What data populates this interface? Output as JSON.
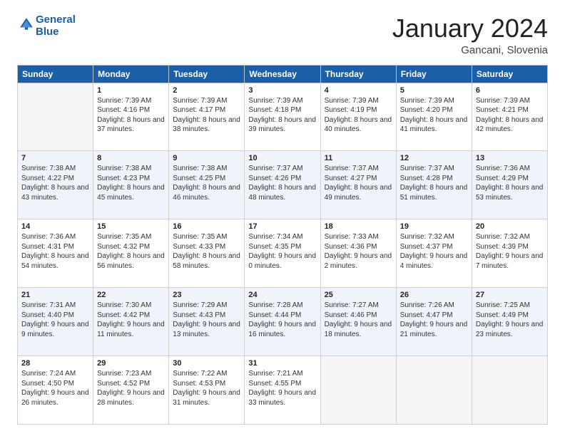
{
  "header": {
    "logo_line1": "General",
    "logo_line2": "Blue",
    "month": "January 2024",
    "location": "Gancani, Slovenia"
  },
  "days_of_week": [
    "Sunday",
    "Monday",
    "Tuesday",
    "Wednesday",
    "Thursday",
    "Friday",
    "Saturday"
  ],
  "weeks": [
    [
      {
        "day": "",
        "sunrise": "",
        "sunset": "",
        "daylight": ""
      },
      {
        "day": "1",
        "sunrise": "Sunrise: 7:39 AM",
        "sunset": "Sunset: 4:16 PM",
        "daylight": "Daylight: 8 hours and 37 minutes."
      },
      {
        "day": "2",
        "sunrise": "Sunrise: 7:39 AM",
        "sunset": "Sunset: 4:17 PM",
        "daylight": "Daylight: 8 hours and 38 minutes."
      },
      {
        "day": "3",
        "sunrise": "Sunrise: 7:39 AM",
        "sunset": "Sunset: 4:18 PM",
        "daylight": "Daylight: 8 hours and 39 minutes."
      },
      {
        "day": "4",
        "sunrise": "Sunrise: 7:39 AM",
        "sunset": "Sunset: 4:19 PM",
        "daylight": "Daylight: 8 hours and 40 minutes."
      },
      {
        "day": "5",
        "sunrise": "Sunrise: 7:39 AM",
        "sunset": "Sunset: 4:20 PM",
        "daylight": "Daylight: 8 hours and 41 minutes."
      },
      {
        "day": "6",
        "sunrise": "Sunrise: 7:39 AM",
        "sunset": "Sunset: 4:21 PM",
        "daylight": "Daylight: 8 hours and 42 minutes."
      }
    ],
    [
      {
        "day": "7",
        "sunrise": "Sunrise: 7:38 AM",
        "sunset": "Sunset: 4:22 PM",
        "daylight": "Daylight: 8 hours and 43 minutes."
      },
      {
        "day": "8",
        "sunrise": "Sunrise: 7:38 AM",
        "sunset": "Sunset: 4:23 PM",
        "daylight": "Daylight: 8 hours and 45 minutes."
      },
      {
        "day": "9",
        "sunrise": "Sunrise: 7:38 AM",
        "sunset": "Sunset: 4:25 PM",
        "daylight": "Daylight: 8 hours and 46 minutes."
      },
      {
        "day": "10",
        "sunrise": "Sunrise: 7:37 AM",
        "sunset": "Sunset: 4:26 PM",
        "daylight": "Daylight: 8 hours and 48 minutes."
      },
      {
        "day": "11",
        "sunrise": "Sunrise: 7:37 AM",
        "sunset": "Sunset: 4:27 PM",
        "daylight": "Daylight: 8 hours and 49 minutes."
      },
      {
        "day": "12",
        "sunrise": "Sunrise: 7:37 AM",
        "sunset": "Sunset: 4:28 PM",
        "daylight": "Daylight: 8 hours and 51 minutes."
      },
      {
        "day": "13",
        "sunrise": "Sunrise: 7:36 AM",
        "sunset": "Sunset: 4:29 PM",
        "daylight": "Daylight: 8 hours and 53 minutes."
      }
    ],
    [
      {
        "day": "14",
        "sunrise": "Sunrise: 7:36 AM",
        "sunset": "Sunset: 4:31 PM",
        "daylight": "Daylight: 8 hours and 54 minutes."
      },
      {
        "day": "15",
        "sunrise": "Sunrise: 7:35 AM",
        "sunset": "Sunset: 4:32 PM",
        "daylight": "Daylight: 8 hours and 56 minutes."
      },
      {
        "day": "16",
        "sunrise": "Sunrise: 7:35 AM",
        "sunset": "Sunset: 4:33 PM",
        "daylight": "Daylight: 8 hours and 58 minutes."
      },
      {
        "day": "17",
        "sunrise": "Sunrise: 7:34 AM",
        "sunset": "Sunset: 4:35 PM",
        "daylight": "Daylight: 9 hours and 0 minutes."
      },
      {
        "day": "18",
        "sunrise": "Sunrise: 7:33 AM",
        "sunset": "Sunset: 4:36 PM",
        "daylight": "Daylight: 9 hours and 2 minutes."
      },
      {
        "day": "19",
        "sunrise": "Sunrise: 7:32 AM",
        "sunset": "Sunset: 4:37 PM",
        "daylight": "Daylight: 9 hours and 4 minutes."
      },
      {
        "day": "20",
        "sunrise": "Sunrise: 7:32 AM",
        "sunset": "Sunset: 4:39 PM",
        "daylight": "Daylight: 9 hours and 7 minutes."
      }
    ],
    [
      {
        "day": "21",
        "sunrise": "Sunrise: 7:31 AM",
        "sunset": "Sunset: 4:40 PM",
        "daylight": "Daylight: 9 hours and 9 minutes."
      },
      {
        "day": "22",
        "sunrise": "Sunrise: 7:30 AM",
        "sunset": "Sunset: 4:42 PM",
        "daylight": "Daylight: 9 hours and 11 minutes."
      },
      {
        "day": "23",
        "sunrise": "Sunrise: 7:29 AM",
        "sunset": "Sunset: 4:43 PM",
        "daylight": "Daylight: 9 hours and 13 minutes."
      },
      {
        "day": "24",
        "sunrise": "Sunrise: 7:28 AM",
        "sunset": "Sunset: 4:44 PM",
        "daylight": "Daylight: 9 hours and 16 minutes."
      },
      {
        "day": "25",
        "sunrise": "Sunrise: 7:27 AM",
        "sunset": "Sunset: 4:46 PM",
        "daylight": "Daylight: 9 hours and 18 minutes."
      },
      {
        "day": "26",
        "sunrise": "Sunrise: 7:26 AM",
        "sunset": "Sunset: 4:47 PM",
        "daylight": "Daylight: 9 hours and 21 minutes."
      },
      {
        "day": "27",
        "sunrise": "Sunrise: 7:25 AM",
        "sunset": "Sunset: 4:49 PM",
        "daylight": "Daylight: 9 hours and 23 minutes."
      }
    ],
    [
      {
        "day": "28",
        "sunrise": "Sunrise: 7:24 AM",
        "sunset": "Sunset: 4:50 PM",
        "daylight": "Daylight: 9 hours and 26 minutes."
      },
      {
        "day": "29",
        "sunrise": "Sunrise: 7:23 AM",
        "sunset": "Sunset: 4:52 PM",
        "daylight": "Daylight: 9 hours and 28 minutes."
      },
      {
        "day": "30",
        "sunrise": "Sunrise: 7:22 AM",
        "sunset": "Sunset: 4:53 PM",
        "daylight": "Daylight: 9 hours and 31 minutes."
      },
      {
        "day": "31",
        "sunrise": "Sunrise: 7:21 AM",
        "sunset": "Sunset: 4:55 PM",
        "daylight": "Daylight: 9 hours and 33 minutes."
      },
      {
        "day": "",
        "sunrise": "",
        "sunset": "",
        "daylight": ""
      },
      {
        "day": "",
        "sunrise": "",
        "sunset": "",
        "daylight": ""
      },
      {
        "day": "",
        "sunrise": "",
        "sunset": "",
        "daylight": ""
      }
    ]
  ]
}
